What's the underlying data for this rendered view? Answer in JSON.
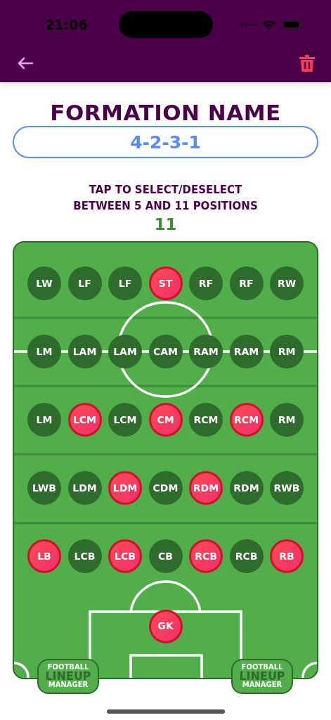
{
  "status_bar": {
    "time": "21:06"
  },
  "header": {
    "title": "FORMATION NAME",
    "name_field": {
      "value": "4-2-3-1"
    }
  },
  "instructions": "TAP TO SELECT/DESELECT\nBETWEEN 5 AND 11 POSITIONS",
  "selected_count": "11",
  "pitch": {
    "rows": [
      {
        "positions": [
          {
            "label": "LW",
            "selected": false
          },
          {
            "label": "LF",
            "selected": false
          },
          {
            "label": "LF",
            "selected": false
          },
          {
            "label": "ST",
            "selected": true
          },
          {
            "label": "RF",
            "selected": false
          },
          {
            "label": "RF",
            "selected": false
          },
          {
            "label": "RW",
            "selected": false
          }
        ]
      },
      {
        "positions": [
          {
            "label": "LM",
            "selected": false
          },
          {
            "label": "LAM",
            "selected": false
          },
          {
            "label": "LAM",
            "selected": false
          },
          {
            "label": "CAM",
            "selected": false
          },
          {
            "label": "RAM",
            "selected": false
          },
          {
            "label": "RAM",
            "selected": false
          },
          {
            "label": "RM",
            "selected": false
          }
        ]
      },
      {
        "positions": [
          {
            "label": "LM",
            "selected": false
          },
          {
            "label": "LCM",
            "selected": true
          },
          {
            "label": "LCM",
            "selected": false
          },
          {
            "label": "CM",
            "selected": true
          },
          {
            "label": "RCM",
            "selected": false
          },
          {
            "label": "RCM",
            "selected": true
          },
          {
            "label": "RM",
            "selected": false
          }
        ]
      },
      {
        "positions": [
          {
            "label": "LWB",
            "selected": false
          },
          {
            "label": "LDM",
            "selected": false
          },
          {
            "label": "LDM",
            "selected": true
          },
          {
            "label": "CDM",
            "selected": false
          },
          {
            "label": "RDM",
            "selected": true
          },
          {
            "label": "RDM",
            "selected": false
          },
          {
            "label": "RWB",
            "selected": false
          }
        ]
      },
      {
        "positions": [
          {
            "label": "LB",
            "selected": true
          },
          {
            "label": "LCB",
            "selected": false
          },
          {
            "label": "LCB",
            "selected": true
          },
          {
            "label": "CB",
            "selected": false
          },
          {
            "label": "RCB",
            "selected": true
          },
          {
            "label": "RCB",
            "selected": false
          },
          {
            "label": "RB",
            "selected": true
          }
        ]
      },
      {
        "positions": [
          {
            "label": "GK",
            "selected": true
          }
        ]
      }
    ],
    "badges": [
      {
        "lines": [
          "FOOTBALL",
          "LINEUP",
          "MANAGER"
        ]
      },
      {
        "lines": [
          "FOOTBALL",
          "LINEUP",
          "MANAGER"
        ]
      }
    ]
  }
}
